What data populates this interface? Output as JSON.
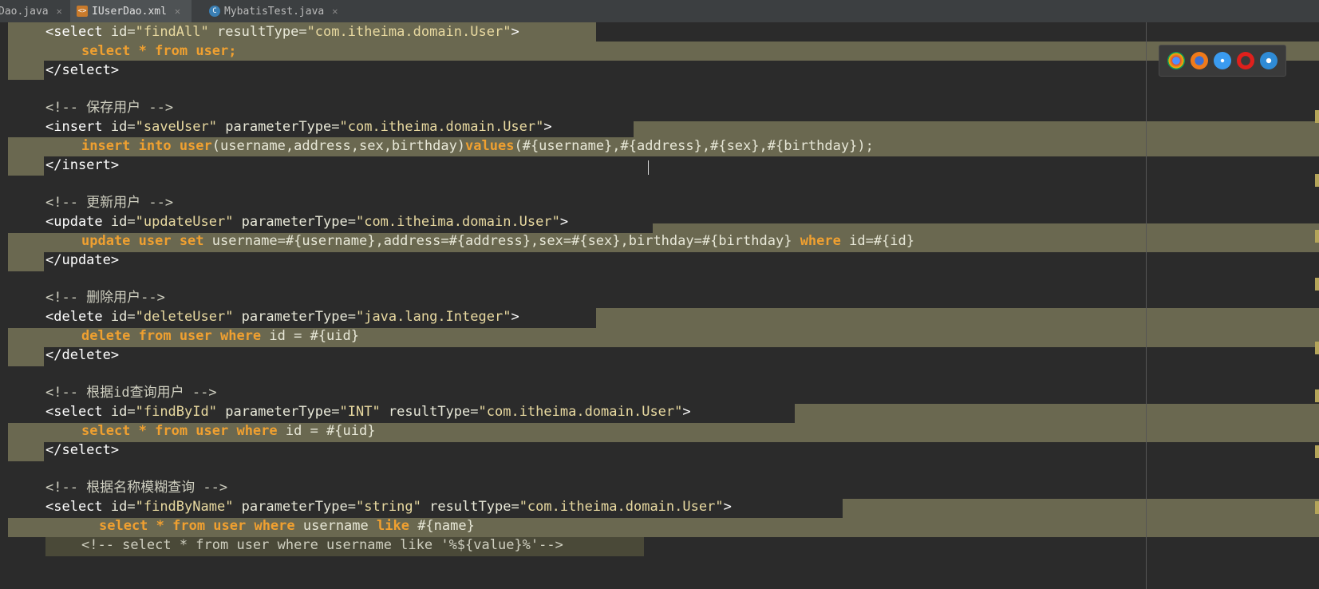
{
  "tabs": [
    {
      "label": "Dao.java",
      "active": false
    },
    {
      "label": "IUserDao.xml",
      "active": true
    },
    {
      "label": "MybatisTest.java",
      "active": false
    }
  ],
  "code": [
    {
      "tokens": [
        [
          "tag",
          "<select "
        ],
        [
          "attr",
          "id="
        ],
        [
          "val",
          "\"findAll\""
        ],
        [
          "attr",
          " resultType="
        ],
        [
          "val",
          "\"com.itheima.domain.User\""
        ],
        [
          "tag",
          ">"
        ]
      ]
    },
    {
      "tokens": [
        [
          "kw",
          "select "
        ],
        [
          "kw",
          "* "
        ],
        [
          "kw",
          "from "
        ],
        [
          "kw",
          "user;"
        ]
      ]
    },
    {
      "tokens": [
        [
          "tag",
          "</select>"
        ]
      ]
    },
    {
      "tokens": []
    },
    {
      "tokens": [
        [
          "cmt",
          "<!-- 保存用户 -->"
        ]
      ]
    },
    {
      "tokens": [
        [
          "tag",
          "<insert "
        ],
        [
          "attr",
          "id="
        ],
        [
          "val",
          "\"saveUser\""
        ],
        [
          "attr",
          " parameterType="
        ],
        [
          "val",
          "\"com.itheima.domain.User\""
        ],
        [
          "tag",
          ">"
        ]
      ]
    },
    {
      "tokens": [
        [
          "kw",
          "insert into user"
        ],
        [
          "id",
          "(username,address,sex,birthday)"
        ],
        [
          "kw",
          "values"
        ],
        [
          "id",
          "(#{username},#{address},#{sex},#{birthday});"
        ]
      ]
    },
    {
      "tokens": [
        [
          "tag",
          "</insert>"
        ]
      ]
    },
    {
      "tokens": []
    },
    {
      "tokens": [
        [
          "cmt",
          "<!-- 更新用户 -->"
        ]
      ]
    },
    {
      "tokens": [
        [
          "tag",
          "<update "
        ],
        [
          "attr",
          "id="
        ],
        [
          "val",
          "\"updateUser\""
        ],
        [
          "attr",
          " parameterType="
        ],
        [
          "val",
          "\"com.itheima.domain.User\""
        ],
        [
          "tag",
          ">"
        ]
      ]
    },
    {
      "tokens": [
        [
          "kw",
          "update user set "
        ],
        [
          "id",
          "username=#{username},address=#{address},sex=#{sex},birthday=#{birthday} "
        ],
        [
          "kw",
          "where "
        ],
        [
          "id",
          "id=#{id}"
        ]
      ]
    },
    {
      "tokens": [
        [
          "tag",
          "</update>"
        ]
      ]
    },
    {
      "tokens": []
    },
    {
      "tokens": [
        [
          "cmt",
          "<!-- 删除用户-->"
        ]
      ]
    },
    {
      "tokens": [
        [
          "tag",
          "<delete "
        ],
        [
          "attr",
          "id="
        ],
        [
          "val",
          "\"deleteUser\""
        ],
        [
          "attr",
          " parameterType="
        ],
        [
          "val",
          "\"java.lang.Integer\""
        ],
        [
          "tag",
          ">"
        ]
      ]
    },
    {
      "tokens": [
        [
          "kw",
          "delete from user where "
        ],
        [
          "id",
          "id = #{uid}"
        ]
      ]
    },
    {
      "tokens": [
        [
          "tag",
          "</delete>"
        ]
      ]
    },
    {
      "tokens": []
    },
    {
      "tokens": [
        [
          "cmt",
          "<!-- 根据id查询用户 -->"
        ]
      ]
    },
    {
      "tokens": [
        [
          "tag",
          "<select "
        ],
        [
          "attr",
          "id="
        ],
        [
          "val",
          "\"findById\""
        ],
        [
          "attr",
          " parameterType="
        ],
        [
          "val",
          "\"INT\""
        ],
        [
          "attr",
          " resultType="
        ],
        [
          "val",
          "\"com.itheima.domain.User\""
        ],
        [
          "tag",
          ">"
        ]
      ]
    },
    {
      "tokens": [
        [
          "kw",
          "select * from user where "
        ],
        [
          "id",
          "id = #{uid}"
        ]
      ]
    },
    {
      "tokens": [
        [
          "tag",
          "</select>"
        ]
      ]
    },
    {
      "tokens": []
    },
    {
      "tokens": [
        [
          "cmt",
          "<!-- 根据名称模糊查询 -->"
        ]
      ]
    },
    {
      "tokens": [
        [
          "tag",
          "<select "
        ],
        [
          "attr",
          "id="
        ],
        [
          "val",
          "\"findByName\""
        ],
        [
          "attr",
          " parameterType="
        ],
        [
          "val",
          "\"string\""
        ],
        [
          "attr",
          " resultType="
        ],
        [
          "val",
          "\"com.itheima.domain.User\""
        ],
        [
          "tag",
          ">"
        ]
      ]
    },
    {
      "tokens": [
        [
          "kw",
          "select * from user where "
        ],
        [
          "id",
          "username "
        ],
        [
          "kw",
          "like "
        ],
        [
          "id",
          "#{name}"
        ]
      ]
    },
    {
      "tokens": [
        [
          "cmt",
          "<!-- select * from user where username like '%${value}%'-->"
        ]
      ]
    }
  ],
  "browsers": [
    "chrome-icon",
    "firefox-icon",
    "safari-icon",
    "opera-icon",
    "ie-icon"
  ],
  "colors": {
    "tag": "#ffffff",
    "value": "#e8d9a0",
    "keyword": "#f0a030",
    "highlight": "#6a6850",
    "background": "#2b2b2b"
  }
}
